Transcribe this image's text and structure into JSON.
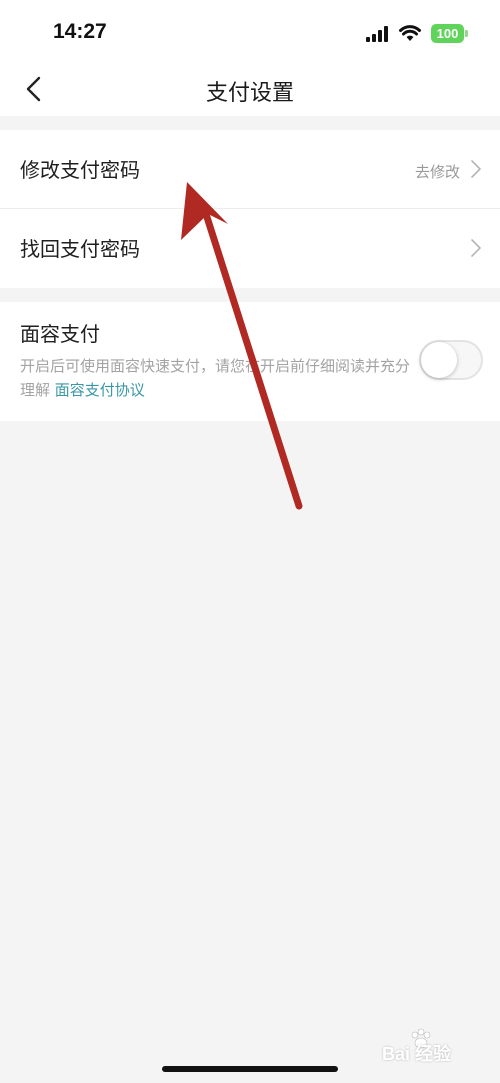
{
  "status_bar": {
    "time": "14:27",
    "battery": "100",
    "battery_color": "#5fd35a"
  },
  "nav": {
    "title": "支付设置",
    "back_icon": "chevron-left-icon"
  },
  "settings": {
    "change_password": {
      "label": "修改支付密码",
      "hint": "去修改"
    },
    "recover_password": {
      "label": "找回支付密码"
    },
    "face_pay": {
      "title": "面容支付",
      "description": "开启后可使用面容快速支付，请您在开启前仔细阅读并充分理解",
      "link": "面容支付协议",
      "enabled": false
    }
  },
  "annotation": {
    "arrow_color": "#b02a23"
  },
  "watermark": {
    "text": "Bai 经验"
  },
  "colors": {
    "background": "#f4f4f4",
    "link": "#3a97a6"
  }
}
